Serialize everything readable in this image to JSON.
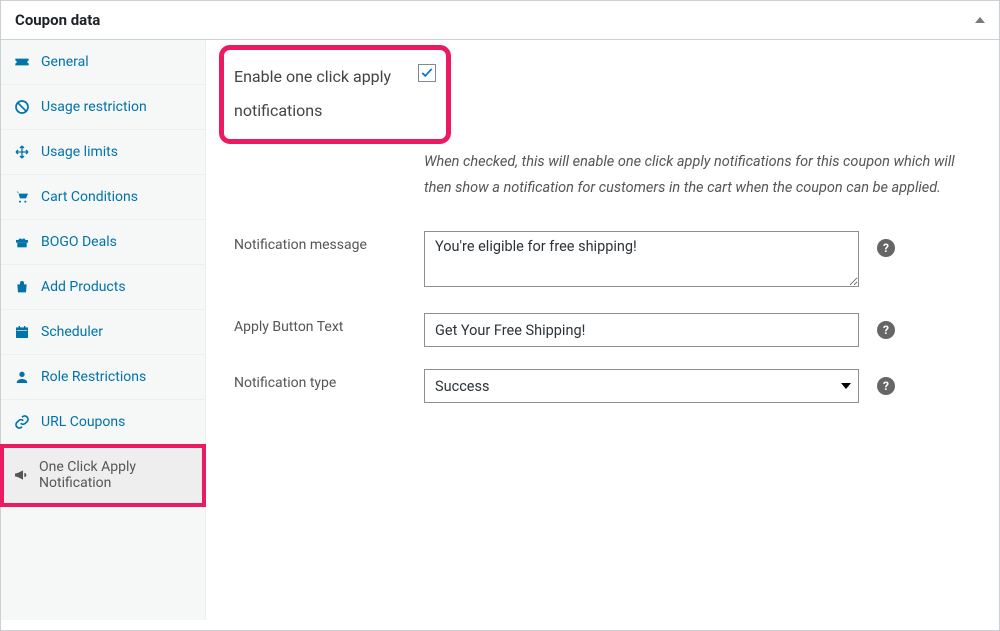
{
  "panel": {
    "title": "Coupon data"
  },
  "sidebar": {
    "items": [
      {
        "label": "General"
      },
      {
        "label": "Usage restriction"
      },
      {
        "label": "Usage limits"
      },
      {
        "label": "Cart Conditions"
      },
      {
        "label": "BOGO Deals"
      },
      {
        "label": "Add Products"
      },
      {
        "label": "Scheduler"
      },
      {
        "label": "Role Restrictions"
      },
      {
        "label": "URL Coupons"
      },
      {
        "label": "One Click Apply Notification"
      }
    ]
  },
  "form": {
    "enable_label": "Enable one click apply notifications",
    "enable_checked": true,
    "description": "When checked, this will enable one click apply notifications for this coupon which will then show a notification for customers in the cart when the coupon can be applied.",
    "message_label": "Notification message",
    "message_value": "You're eligible for free shipping!",
    "button_label": "Apply Button Text",
    "button_value": "Get Your Free Shipping!",
    "type_label": "Notification type",
    "type_value": "Success"
  },
  "glyphs": {
    "help": "?"
  }
}
